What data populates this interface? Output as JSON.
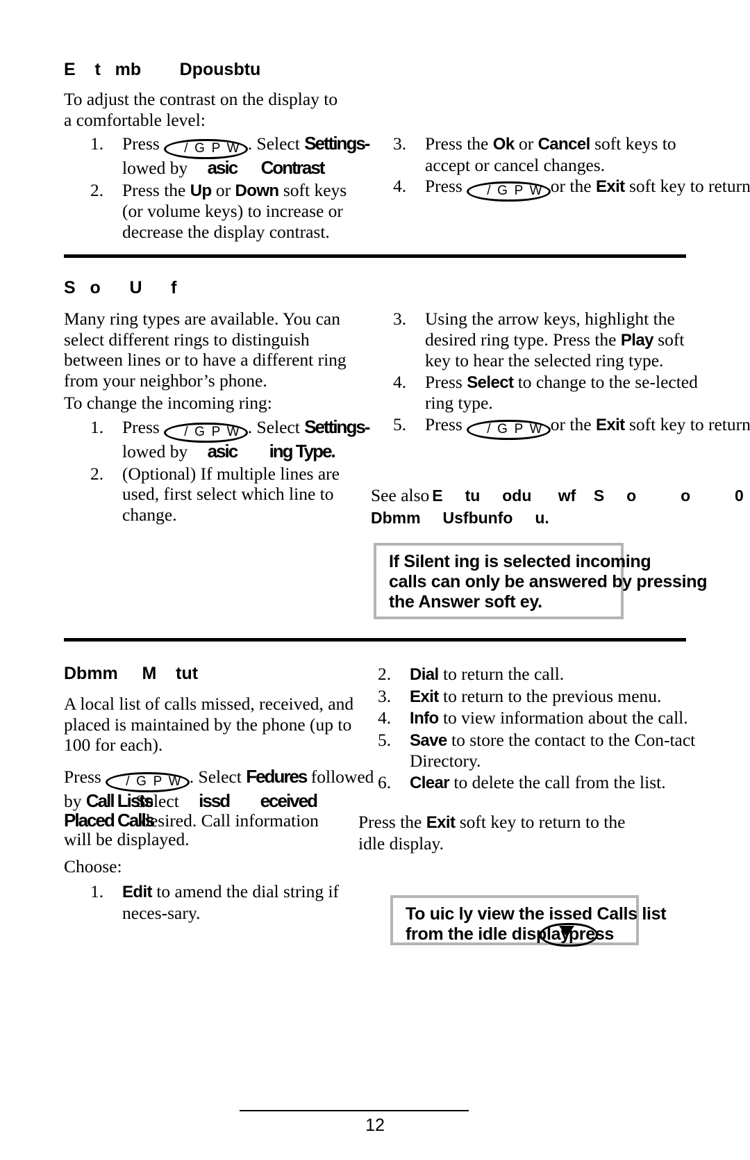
{
  "document": {
    "page_number": "12",
    "key_glyph": "/ G P W",
    "key_glyph_down": "/ G P W"
  },
  "sections": [
    {
      "id": "display-contrast",
      "heading": "E    t   mb        Dpousbtu",
      "intro": "To adjust the contrast on the display to a comfortable level:",
      "steps_left": [
        {
          "num": "1.",
          "pre": "Press",
          "key": "/ G P W",
          "mid": ". Select",
          "bold1": "Settings",
          "tail": "-",
          "line2_pre": "lowed by",
          "bold2": "asic",
          "bold3": "Contrast"
        },
        {
          "num": "2.",
          "text_pre": "Press the",
          "bold_a": "Up",
          "mid_a": "or",
          "bold_b": "Down",
          "text_post": "soft keys (or volume keys) to increase or decrease the display contrast."
        }
      ],
      "steps_right": [
        {
          "num": "3.",
          "pre": "Press the",
          "bold_a": "Ok",
          "mid": "or",
          "bold_b": "Cancel",
          "post": "soft keys to accept or cancel changes."
        },
        {
          "num": "4.",
          "pre": "Press",
          "key": "/ G P W",
          "mid": "or the",
          "bold_a": "Exit",
          "post": "soft key to return to the idle display."
        }
      ]
    },
    {
      "id": "ring-type",
      "heading": "S   o      U      f",
      "para1": "Many ring types are available.  You can select different rings to distinguish between lines or to have a different ring from your neighbor’s phone.",
      "para2": "To change the incoming ring:",
      "steps_left": [
        {
          "num": "1.",
          "pre": "Press",
          "key": "/ G P W",
          "mid": ". Select",
          "bold1": "Settings",
          "tail": "-",
          "line2_pre": "lowed by",
          "bold2": "asic",
          "bold3": "ing Type."
        },
        {
          "num": "2.",
          "text": "(Optional)  If multiple lines are used, first select which line to change."
        }
      ],
      "steps_right": [
        {
          "num": "3.",
          "pre": "Using the arrow keys, highlight the desired ring type.  Press the",
          "bold_a": "Play",
          "post": "soft key to hear the selected ring type."
        },
        {
          "num": "4.",
          "pre": "Press",
          "bold_a": "Select",
          "post": "to change to the se-lected ring type."
        },
        {
          "num": "5.",
          "pre": "Press",
          "key": "/ G P W",
          "mid": "or the",
          "bold_a": "Exit",
          "post": "soft key to return to the idle display."
        }
      ],
      "see_also": {
        "label": "See also",
        "ref_line1": "E     tu     odu      wf    S     o          o          0",
        "ref_line2": "Dbmm     Usfbunfo     u."
      },
      "note": {
        "line1": "If      Silent      ing    is selected    incoming",
        "line2": "calls can only be answered by pressing",
        "line3": "the Answer soft     ey."
      }
    },
    {
      "id": "call-lists",
      "heading": "Dbmm     M    tut",
      "para1": "A local list of calls missed, received, and placed is maintained by the phone (up to 100 for each).",
      "press_line": {
        "pre": "Press",
        "key": "/ G P W",
        "mid": ". Select",
        "bold1": "Fedures",
        "post1": "followed",
        "line2_pre": "by",
        "bold2": "Call Lists",
        "post2": "Select",
        "bold3": "issd",
        "bold4": "eceived",
        "line3_bold": "Placed Calls",
        "line3_post": "desired.  Call information",
        "line4": "will be displayed."
      },
      "choose_label": "Choose:",
      "steps_left": [
        {
          "num": "1.",
          "bold": "Edit",
          "text": "to amend the dial string if neces-sary."
        }
      ],
      "steps_right": [
        {
          "num": "2.",
          "bold": "Dial",
          "text": "to return the call."
        },
        {
          "num": "3.",
          "bold": "Exit",
          "text": "to return to the previous menu."
        },
        {
          "num": "4.",
          "bold": "Info",
          "text": "to view information about the call."
        },
        {
          "num": "5.",
          "bold": "Save",
          "text": "to store the contact to the Con-tact Directory."
        },
        {
          "num": "6.",
          "bold": "Clear",
          "text": "to delete the call from the list."
        }
      ],
      "closing": {
        "pre": "Press the",
        "bold": "Exit",
        "post": "soft key to return to the idle display."
      },
      "note": {
        "line1": "To     uic   ly view the     issed Calls list",
        "line2_a": "from the idle display",
        "line2_b": "press"
      }
    }
  ]
}
